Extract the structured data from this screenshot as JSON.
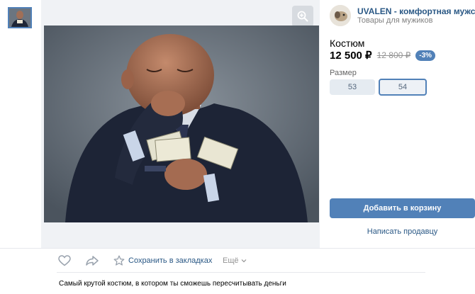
{
  "shop": {
    "name": "UVALEN - комфортная мужска...",
    "subtitle": "Товары для мужиков"
  },
  "product": {
    "title": "Костюм",
    "price": "12 500 ₽",
    "old_price": "12 800 ₽",
    "discount": "-3%",
    "size_label": "Размер",
    "sizes": [
      "53",
      "54"
    ],
    "selected_size": "54",
    "add_to_cart": "Добавить в корзину",
    "message_seller": "Написать продавцу",
    "description": "Самый крутой костюм, в котором ты сможешь пересчитывать деньги"
  },
  "actions": {
    "bookmark": "Сохранить в закладках",
    "more": "Ещё"
  },
  "icons": {
    "zoom": "zoom-in-icon",
    "like": "heart-icon",
    "share": "share-arrow-icon",
    "bookmark": "star-icon",
    "more": "chevron-down-icon"
  },
  "colors": {
    "accent": "#5181b8",
    "link": "#2a5885"
  }
}
